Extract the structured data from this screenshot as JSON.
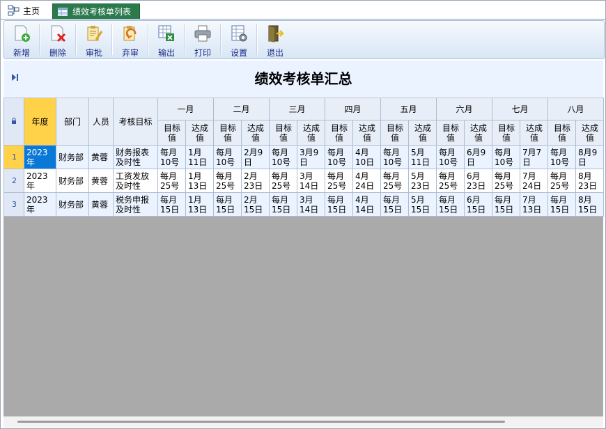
{
  "tabs": {
    "home_label": "主页",
    "active_label": "绩效考核单列表"
  },
  "toolbar": {
    "buttons": [
      {
        "label": "新增",
        "icon": "add-document-icon"
      },
      {
        "label": "删除",
        "icon": "delete-document-icon"
      },
      {
        "label": "审批",
        "icon": "approve-icon"
      },
      {
        "label": "弃审",
        "icon": "unapprove-icon"
      },
      {
        "label": "输出",
        "icon": "export-excel-icon"
      },
      {
        "label": "打印",
        "icon": "printer-icon"
      },
      {
        "label": "设置",
        "icon": "settings-icon"
      },
      {
        "label": "退出",
        "icon": "exit-door-icon"
      }
    ]
  },
  "report": {
    "title": "绩效考核单汇总"
  },
  "grid": {
    "col_year": "年度",
    "col_dept": "部门",
    "col_person": "人员",
    "col_target": "考核目标",
    "months": [
      "一月",
      "二月",
      "三月",
      "四月",
      "五月",
      "六月",
      "七月",
      "八月"
    ],
    "sub_target": "目标值",
    "sub_done": "达成值",
    "rows": [
      {
        "no": "1",
        "year": "2023年",
        "dept": "财务部",
        "person": "黄蓉",
        "target": "财务报表及时性",
        "values": [
          [
            "每月10号",
            "1月11日"
          ],
          [
            "每月10号",
            "2月9日"
          ],
          [
            "每月10号",
            "3月9日"
          ],
          [
            "每月10号",
            "4月10日"
          ],
          [
            "每月10号",
            "5月11日"
          ],
          [
            "每月10号",
            "6月9日"
          ],
          [
            "每月10号",
            "7月7日"
          ],
          [
            "每月10号",
            "8月9日"
          ]
        ]
      },
      {
        "no": "2",
        "year": "2023年",
        "dept": "财务部",
        "person": "黄蓉",
        "target": "工资发放及时性",
        "values": [
          [
            "每月25号",
            "1月13日"
          ],
          [
            "每月25号",
            "2月23日"
          ],
          [
            "每月25号",
            "3月14日"
          ],
          [
            "每月25号",
            "4月24日"
          ],
          [
            "每月25号",
            "5月23日"
          ],
          [
            "每月25号",
            "6月23日"
          ],
          [
            "每月25号",
            "7月24日"
          ],
          [
            "每月25号",
            "8月23日"
          ]
        ]
      },
      {
        "no": "3",
        "year": "2023年",
        "dept": "财务部",
        "person": "黄蓉",
        "target": "税务申报及时性",
        "values": [
          [
            "每月15日",
            "1月13日"
          ],
          [
            "每月15日",
            "2月15日"
          ],
          [
            "每月15日",
            "3月14日"
          ],
          [
            "每月15日",
            "4月14日"
          ],
          [
            "每月15日",
            "5月15日"
          ],
          [
            "每月15日",
            "6月15日"
          ],
          [
            "每月15日",
            "7月13日"
          ],
          [
            "每月15日",
            "8月15日"
          ]
        ]
      }
    ]
  },
  "colors": {
    "accent_tab": "#2a7a4c",
    "selected_header": "#ffd24a",
    "selected_cell": "#0a78d7"
  }
}
